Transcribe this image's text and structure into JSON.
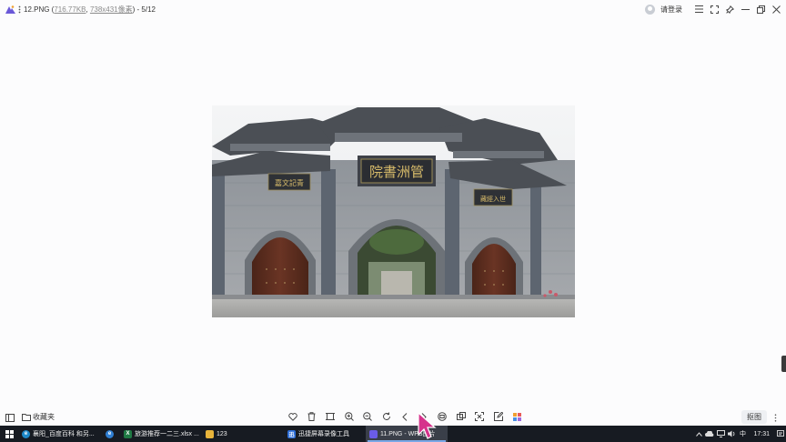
{
  "window": {
    "title_prefix": "12.PNG (",
    "file_size": "716.77KB",
    "separator": ", ",
    "dimensions": "738x431像素",
    "title_suffix": ") - 5/12",
    "login_label": "请登录"
  },
  "toolbar": {
    "favorites_label": "收藏夹",
    "crop_label": "抠图"
  },
  "taskbar": {
    "items": [
      {
        "label": "襄阳_百度百科 和另...",
        "icon": "edge-icon",
        "color": "#1e88c8"
      },
      {
        "label": "",
        "icon": "ie-icon",
        "color": "#2f7fd3"
      },
      {
        "label": "旅游推荐一二三.xlsx ...",
        "icon": "excel-icon",
        "color": "#1f7a44"
      },
      {
        "label": "123",
        "icon": "folder-icon",
        "color": "#e8b43b"
      },
      {
        "label": "迅捷屏幕录像工具",
        "icon": "recorder-icon",
        "color": "#2c6dd8"
      },
      {
        "label": "11.PNG - WPS图片",
        "icon": "wps-photo-icon",
        "color": "#6b5ce7"
      }
    ],
    "clock": "17:31"
  },
  "colors": {
    "accent": "#7aa7e6",
    "taskbar_bg": "#171b22"
  }
}
